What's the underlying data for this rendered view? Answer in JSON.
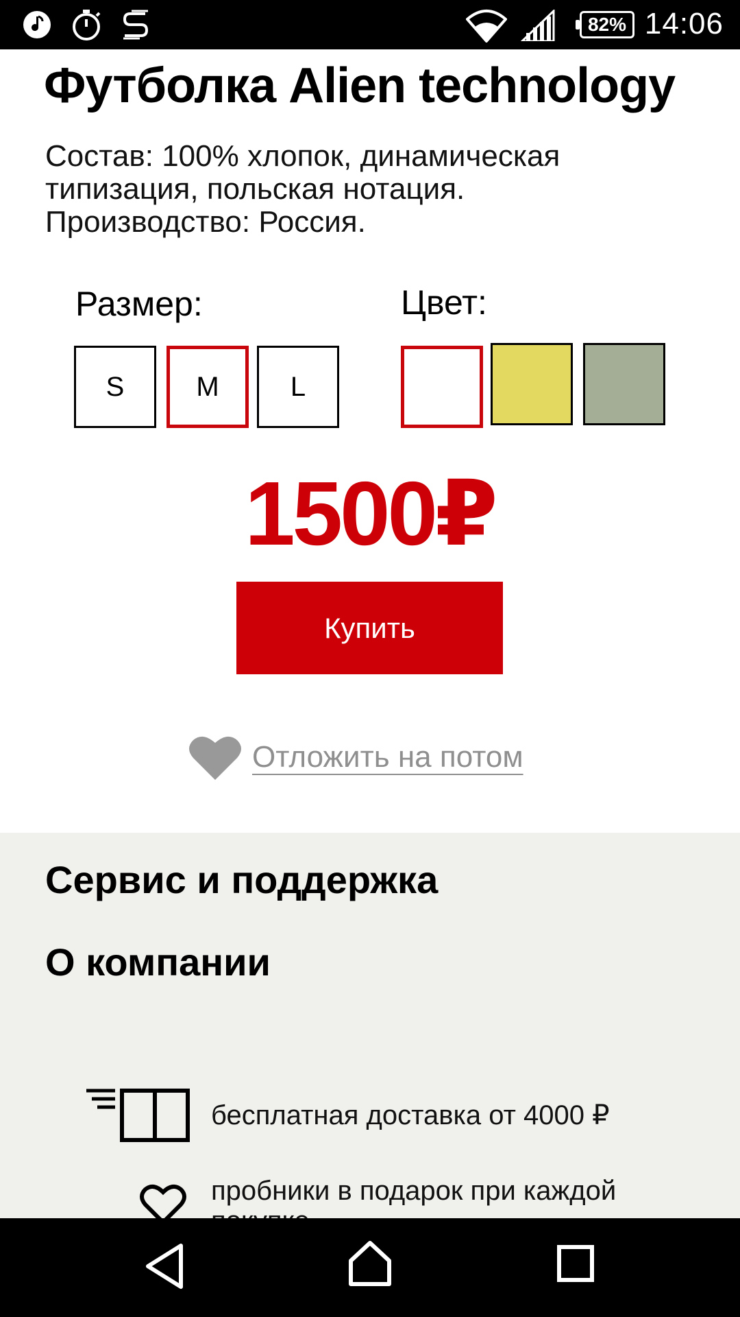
{
  "status_bar": {
    "battery": "82%",
    "time": "14:06"
  },
  "product": {
    "title": "Футболка Alien technology",
    "description_lines": [
      "Состав: 100% хлопок, динамическая",
      "типизация, польская нотация.",
      "Производство: Россия."
    ],
    "size_label": "Размер:",
    "sizes": [
      {
        "label": "S",
        "selected": false
      },
      {
        "label": "M",
        "selected": true
      },
      {
        "label": "L",
        "selected": false
      }
    ],
    "color_label": "Цвет:",
    "colors": [
      {
        "hex": "#ffffff",
        "selected": true
      },
      {
        "hex": "#e3d960",
        "selected": false
      },
      {
        "hex": "#a4ad96",
        "selected": false
      }
    ],
    "price": "1500₽",
    "buy_label": "Купить",
    "later_label": "Отложить на потом"
  },
  "footer": {
    "links": [
      "Сервис и поддержка",
      "О компании"
    ],
    "features": [
      {
        "icon": "delivery-truck-icon",
        "text": "бесплатная доставка от 4000 ₽"
      },
      {
        "icon": "heart-outline-icon",
        "text": "пробники в подарок при каждой покупке"
      }
    ]
  },
  "colors": {
    "accent": "#cc0006",
    "footer_bg": "#f0f0ec",
    "muted_text": "#8f8f8f"
  }
}
